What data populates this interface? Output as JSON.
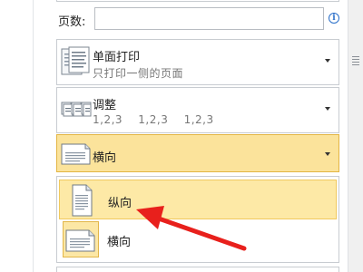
{
  "pages": {
    "label": "页数:",
    "value": ""
  },
  "options": [
    {
      "title": "单面打印",
      "subtitle": "只打印一侧的页面",
      "icon": "single-side-print-icon"
    },
    {
      "title": "调整",
      "subtitle": "1,2,3    1,2,3    1,2,3",
      "icon": "collate-icon"
    }
  ],
  "orientation": {
    "selected": "横向",
    "icon": "landscape-page-icon",
    "items": [
      {
        "label": "纵向",
        "icon": "portrait-page-icon"
      },
      {
        "label": "横向",
        "icon": "landscape-page-icon"
      }
    ]
  },
  "colors": {
    "selected_bg": "#fbe39b",
    "hover_bg": "#fde9a6",
    "arrow": "#e8201c",
    "info": "#2a6fc9"
  }
}
